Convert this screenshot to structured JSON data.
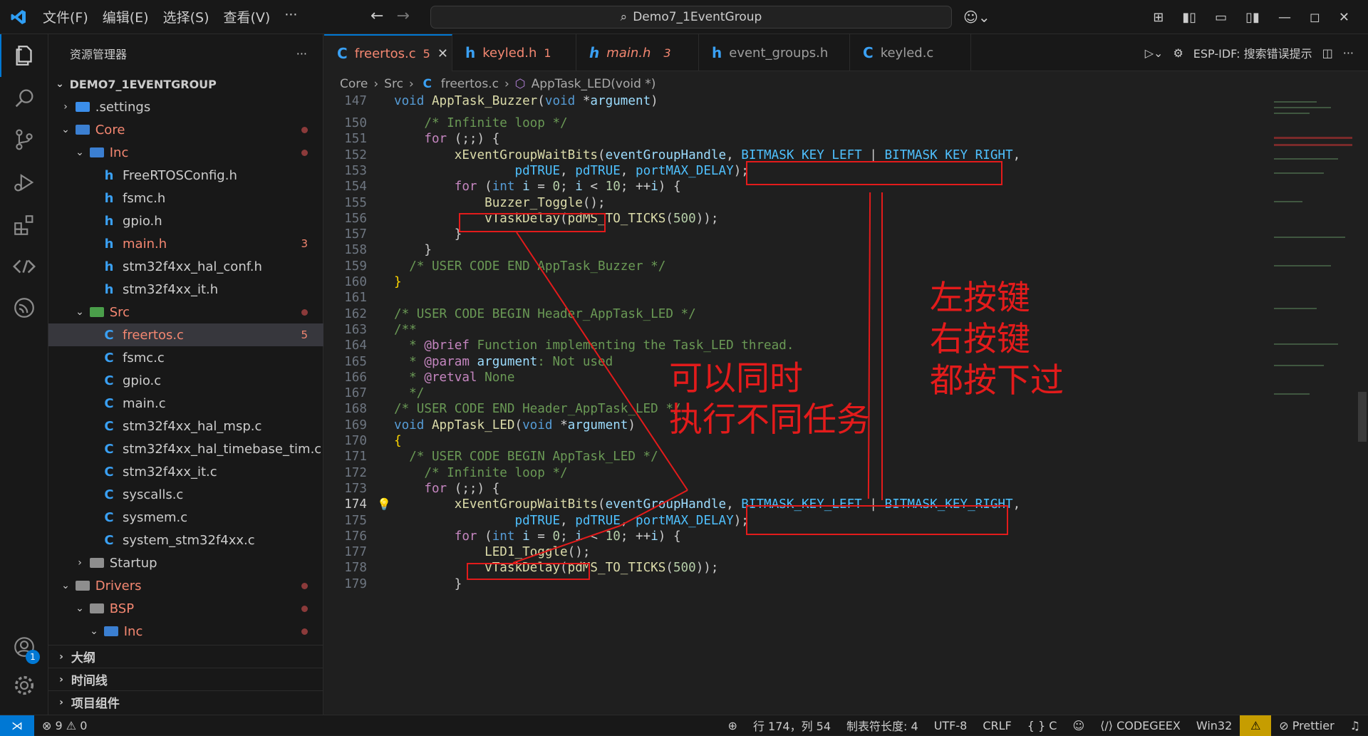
{
  "menu": {
    "file": "文件(F)",
    "edit": "编辑(E)",
    "select": "选择(S)",
    "view": "查看(V)",
    "more": "···"
  },
  "search": {
    "text": "Demo7_1EventGroup"
  },
  "sidebar": {
    "title": "资源管理器",
    "root": "DEMO7_1EVENTGROUP",
    "items": [
      {
        "label": ".settings"
      },
      {
        "label": "Core"
      },
      {
        "label": "Inc"
      },
      {
        "label": "FreeRTOSConfig.h"
      },
      {
        "label": "fsmc.h"
      },
      {
        "label": "gpio.h"
      },
      {
        "label": "main.h",
        "count": "3"
      },
      {
        "label": "stm32f4xx_hal_conf.h"
      },
      {
        "label": "stm32f4xx_it.h"
      },
      {
        "label": "Src"
      },
      {
        "label": "freertos.c",
        "count": "5"
      },
      {
        "label": "fsmc.c"
      },
      {
        "label": "gpio.c"
      },
      {
        "label": "main.c"
      },
      {
        "label": "stm32f4xx_hal_msp.c"
      },
      {
        "label": "stm32f4xx_hal_timebase_tim.c"
      },
      {
        "label": "stm32f4xx_it.c"
      },
      {
        "label": "syscalls.c"
      },
      {
        "label": "sysmem.c"
      },
      {
        "label": "system_stm32f4xx.c"
      },
      {
        "label": "Startup"
      },
      {
        "label": "Drivers"
      },
      {
        "label": "BSP"
      },
      {
        "label": "Inc"
      }
    ],
    "sections": {
      "outline": "大纲",
      "timeline": "时间线",
      "components": "项目组件"
    }
  },
  "tabs": [
    {
      "label": "freertos.c",
      "count": "5",
      "icon": "C"
    },
    {
      "label": "keyled.h",
      "count": "1",
      "icon": "h"
    },
    {
      "label": "main.h",
      "count": "3",
      "icon": "h"
    },
    {
      "label": "event_groups.h",
      "count": "",
      "icon": "h"
    },
    {
      "label": "keyled.c",
      "count": "",
      "icon": "C"
    }
  ],
  "tab_actions": {
    "espidf": "ESP-IDF: 搜索错误提示"
  },
  "breadcrumb": {
    "a": "Core",
    "b": "Src",
    "c": "freertos.c",
    "d": "AppTask_LED(void *)"
  },
  "code": {
    "lines": [
      {
        "n": "147",
        "segs": [
          [
            "ty",
            "void "
          ],
          [
            "fn",
            "AppTask_Buzzer"
          ],
          [
            "",
            "("
          ],
          [
            "ty",
            "void "
          ],
          [
            "",
            "*"
          ],
          [
            "pa",
            "argument"
          ],
          [
            "",
            ")"
          ]
        ]
      },
      {
        "n": "150",
        "segs": [
          [
            "",
            "    "
          ],
          [
            "cm",
            "/* Infinite loop */"
          ]
        ]
      },
      {
        "n": "151",
        "segs": [
          [
            "",
            "    "
          ],
          [
            "ct",
            "for"
          ],
          [
            "",
            " ("
          ],
          [
            "",
            ";;"
          ],
          [
            "",
            ") {"
          ]
        ]
      },
      {
        "n": "152",
        "segs": [
          [
            "",
            "        "
          ],
          [
            "fn",
            "xEventGroupWaitBits"
          ],
          [
            "",
            "("
          ],
          [
            "pa",
            "eventGroupHandle"
          ],
          [
            "",
            ", "
          ],
          [
            "mc",
            "BITMASK_KEY_LEFT"
          ],
          [
            "",
            " | "
          ],
          [
            "mc",
            "BITMASK_KEY_RIGHT"
          ],
          [
            "",
            ","
          ]
        ]
      },
      {
        "n": "153",
        "segs": [
          [
            "",
            "                "
          ],
          [
            "mc",
            "pdTRUE"
          ],
          [
            "",
            ", "
          ],
          [
            "mc",
            "pdTRUE"
          ],
          [
            "",
            ", "
          ],
          [
            "mc",
            "portMAX_DELAY"
          ],
          [
            "",
            ");"
          ]
        ]
      },
      {
        "n": "154",
        "segs": [
          [
            "",
            "        "
          ],
          [
            "ct",
            "for"
          ],
          [
            "",
            " ("
          ],
          [
            "ty",
            "int "
          ],
          [
            "pa",
            "i"
          ],
          [
            "",
            " = "
          ],
          [
            "nu",
            "0"
          ],
          [
            "",
            "; "
          ],
          [
            "pa",
            "i"
          ],
          [
            "",
            " < "
          ],
          [
            "nu",
            "10"
          ],
          [
            "",
            "; ++"
          ],
          [
            "pa",
            "i"
          ],
          [
            "",
            ") {"
          ]
        ]
      },
      {
        "n": "155",
        "segs": [
          [
            "",
            "            "
          ],
          [
            "fn",
            "Buzzer_Toggle"
          ],
          [
            "",
            "();"
          ]
        ]
      },
      {
        "n": "156",
        "segs": [
          [
            "",
            "            "
          ],
          [
            "fn",
            "vTaskDelay"
          ],
          [
            "",
            "("
          ],
          [
            "fn",
            "pdMS_TO_TICKS"
          ],
          [
            "",
            "("
          ],
          [
            "nu",
            "500"
          ],
          [
            "",
            "));"
          ]
        ]
      },
      {
        "n": "157",
        "segs": [
          [
            "",
            "        }"
          ]
        ]
      },
      {
        "n": "158",
        "segs": [
          [
            "",
            "    }"
          ]
        ]
      },
      {
        "n": "159",
        "segs": [
          [
            "",
            "  "
          ],
          [
            "cm",
            "/* USER CODE END AppTask_Buzzer */"
          ]
        ]
      },
      {
        "n": "160",
        "segs": [
          [
            "br",
            "}"
          ]
        ]
      },
      {
        "n": "161",
        "segs": []
      },
      {
        "n": "162",
        "segs": [
          [
            "cm",
            "/* USER CODE BEGIN Header_AppTask_LED */"
          ]
        ]
      },
      {
        "n": "163",
        "segs": [
          [
            "cm",
            "/**"
          ]
        ]
      },
      {
        "n": "164",
        "segs": [
          [
            "cm",
            "  * "
          ],
          [
            "ct",
            "@brief"
          ],
          [
            "cm",
            " Function implementing the Task_LED thread."
          ]
        ]
      },
      {
        "n": "165",
        "segs": [
          [
            "cm",
            "  * "
          ],
          [
            "ct",
            "@param"
          ],
          [
            "pa",
            " argument"
          ],
          [
            "cm",
            ": Not used"
          ]
        ]
      },
      {
        "n": "166",
        "segs": [
          [
            "cm",
            "  * "
          ],
          [
            "ct",
            "@retval"
          ],
          [
            "cm",
            " None"
          ]
        ]
      },
      {
        "n": "167",
        "segs": [
          [
            "cm",
            "  */"
          ]
        ]
      },
      {
        "n": "168",
        "segs": [
          [
            "cm",
            "/* USER CODE END Header_AppTask_LED */"
          ]
        ]
      },
      {
        "n": "169",
        "segs": [
          [
            "ty",
            "void "
          ],
          [
            "fn",
            "AppTask_LED"
          ],
          [
            "",
            "("
          ],
          [
            "ty",
            "void "
          ],
          [
            "",
            "*"
          ],
          [
            "pa",
            "argument"
          ],
          [
            "",
            ")"
          ]
        ]
      },
      {
        "n": "170",
        "segs": [
          [
            "br",
            "{"
          ]
        ]
      },
      {
        "n": "171",
        "segs": [
          [
            "",
            "  "
          ],
          [
            "cm",
            "/* USER CODE BEGIN AppTask_LED */"
          ]
        ]
      },
      {
        "n": "172",
        "segs": [
          [
            "",
            "    "
          ],
          [
            "cm",
            "/* Infinite loop */"
          ]
        ]
      },
      {
        "n": "173",
        "segs": [
          [
            "",
            "    "
          ],
          [
            "ct",
            "for"
          ],
          [
            "",
            " ("
          ],
          [
            "",
            ";;"
          ],
          [
            "",
            ") {"
          ]
        ]
      },
      {
        "n": "174",
        "segs": [
          [
            "",
            "        "
          ],
          [
            "fn",
            "xEventGroupWaitBits"
          ],
          [
            "",
            "("
          ],
          [
            "pa",
            "eventGroupHandle"
          ],
          [
            "",
            ", "
          ],
          [
            "mc",
            "BITMASK_KEY_LEFT"
          ],
          [
            "",
            " | "
          ],
          [
            "mc",
            "BITMASK_KEY_RIGHT"
          ],
          [
            "",
            ","
          ]
        ]
      },
      {
        "n": "175",
        "segs": [
          [
            "",
            "                "
          ],
          [
            "mc",
            "pdTRUE"
          ],
          [
            "",
            ", "
          ],
          [
            "mc",
            "pdTRUE"
          ],
          [
            "",
            ", "
          ],
          [
            "mc",
            "portMAX_DELAY"
          ],
          [
            "",
            ");"
          ]
        ]
      },
      {
        "n": "176",
        "segs": [
          [
            "",
            "        "
          ],
          [
            "ct",
            "for"
          ],
          [
            "",
            " ("
          ],
          [
            "ty",
            "int "
          ],
          [
            "pa",
            "i"
          ],
          [
            "",
            " = "
          ],
          [
            "nu",
            "0"
          ],
          [
            "",
            "; "
          ],
          [
            "pa",
            "i"
          ],
          [
            "",
            " < "
          ],
          [
            "nu",
            "10"
          ],
          [
            "",
            "; ++"
          ],
          [
            "pa",
            "i"
          ],
          [
            "",
            ") {"
          ]
        ]
      },
      {
        "n": "177",
        "segs": [
          [
            "",
            "            "
          ],
          [
            "fn",
            "LED1_Toggle"
          ],
          [
            "",
            "();"
          ]
        ]
      },
      {
        "n": "178",
        "segs": [
          [
            "",
            "            "
          ],
          [
            "fn",
            "vTaskDelay"
          ],
          [
            "",
            "("
          ],
          [
            "fn",
            "pdMS_TO_TICKS"
          ],
          [
            "",
            "("
          ],
          [
            "nu",
            "500"
          ],
          [
            "",
            "));"
          ]
        ]
      },
      {
        "n": "179",
        "segs": [
          [
            "",
            "        }"
          ]
        ]
      }
    ]
  },
  "annotations": {
    "right": [
      "左按键",
      "右按键",
      "都按下过"
    ],
    "middle": [
      "可以同时",
      "执行不同任务"
    ]
  },
  "status": {
    "errors": "9",
    "warnings": "0",
    "position": "行 174，列 54",
    "tabsize": "制表符长度: 4",
    "encoding": "UTF-8",
    "eol": "CRLF",
    "lang": "{ } C",
    "codegeex": "CODEGEEX",
    "platform": "Win32",
    "prettier": "Prettier"
  }
}
